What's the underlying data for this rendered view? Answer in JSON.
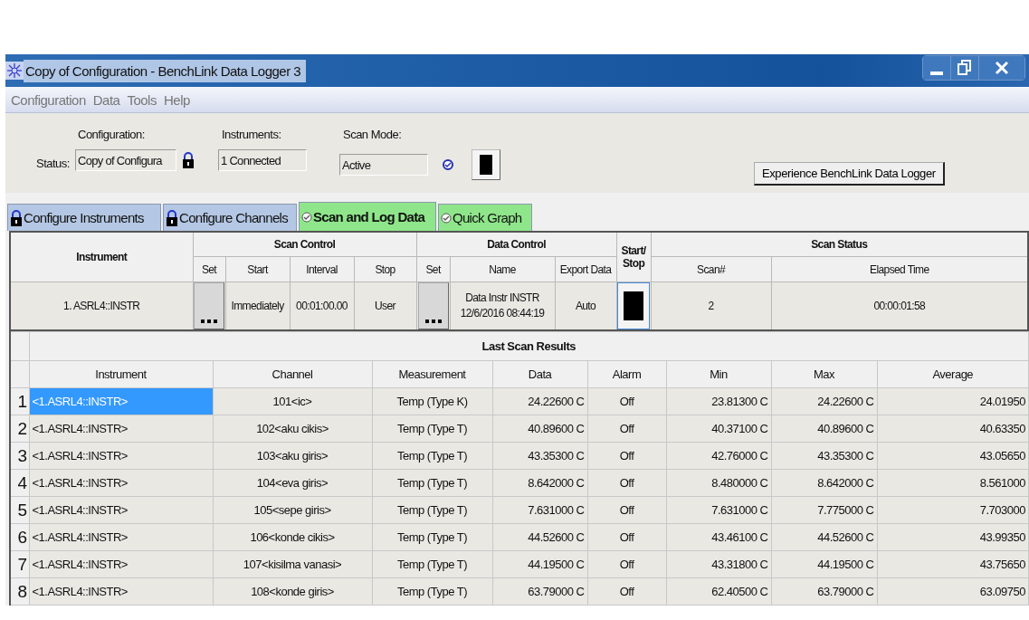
{
  "window": {
    "title": "Copy of Configuration - BenchLink Data Logger 3"
  },
  "menu": [
    "Configuration",
    "Data",
    "Tools",
    "Help"
  ],
  "status_panel": {
    "configuration_label": "Configuration:",
    "status_label": "Status:",
    "configuration_value": "Copy of Configura",
    "locked": true,
    "instruments_label": "Instruments:",
    "instruments_value": "1 Connected",
    "scan_mode_label": "Scan Mode:",
    "scan_mode_value": "Active",
    "scan_mode_checked": true,
    "action_button": "Experience BenchLink Data Logger"
  },
  "tabs": [
    {
      "label": "Configure Instruments",
      "kind": "lock",
      "selected": false
    },
    {
      "label": "Configure Channels",
      "kind": "lock",
      "selected": false
    },
    {
      "label": "Scan and Log Data",
      "kind": "check",
      "selected": true
    },
    {
      "label": "Quick Graph",
      "kind": "check",
      "selected": false
    }
  ],
  "scan_table": {
    "groups": [
      "Instrument",
      "Scan Control",
      "Data  Control",
      "Start/ Stop",
      "Scan Status"
    ],
    "columns": [
      "Set",
      "Start",
      "Interval",
      "Stop",
      "Set",
      "Name",
      "Export Data",
      "Scan#",
      "Elapsed Time"
    ],
    "row": {
      "instrument": "1. ASRL4::INSTR",
      "start": "Immediately",
      "interval": "00:01:00.00",
      "stop": "User",
      "name": "Data Instr INSTR 12/6/2016 08:44:19",
      "export_data": "Auto",
      "scan_number": "2",
      "elapsed_time": "00:00:01:58"
    }
  },
  "results": {
    "title": "Last Scan Results",
    "columns": [
      "Instrument",
      "Channel",
      "Measurement",
      "Data",
      "Alarm",
      "Min",
      "Max",
      "Average"
    ],
    "rows": [
      {
        "number": "1",
        "selected": true,
        "cells": [
          "<1.ASRL4::INSTR>",
          "101<ic>",
          "Temp (Type K)",
          "24.22600 C",
          "Off",
          "23.81300 C",
          "24.22600 C",
          "24.01950"
        ]
      },
      {
        "number": "2",
        "selected": false,
        "cells": [
          "<1.ASRL4::INSTR>",
          "102<aku cikis>",
          "Temp (Type T)",
          "40.89600 C",
          "Off",
          "40.37100 C",
          "40.89600 C",
          "40.63350"
        ]
      },
      {
        "number": "3",
        "selected": false,
        "cells": [
          "<1.ASRL4::INSTR>",
          "103<aku giris>",
          "Temp (Type T)",
          "43.35300 C",
          "Off",
          "42.76000 C",
          "43.35300 C",
          "43.05650"
        ]
      },
      {
        "number": "4",
        "selected": false,
        "cells": [
          "<1.ASRL4::INSTR>",
          "104<eva giris>",
          "Temp (Type T)",
          "8.642000 C",
          "Off",
          "8.480000 C",
          "8.642000 C",
          "8.561000"
        ]
      },
      {
        "number": "5",
        "selected": false,
        "cells": [
          "<1.ASRL4::INSTR>",
          "105<sepe giris>",
          "Temp (Type T)",
          "7.631000 C",
          "Off",
          "7.631000 C",
          "7.775000 C",
          "7.703000"
        ]
      },
      {
        "number": "6",
        "selected": false,
        "cells": [
          "<1.ASRL4::INSTR>",
          "106<konde cikis>",
          "Temp (Type T)",
          "44.52600 C",
          "Off",
          "43.46100 C",
          "44.52600 C",
          "43.99350"
        ]
      },
      {
        "number": "7",
        "selected": false,
        "cells": [
          "<1.ASRL4::INSTR>",
          "107<kisilma vanasi>",
          "Temp (Type T)",
          "44.19500 C",
          "Off",
          "43.31800 C",
          "44.19500 C",
          "43.75650"
        ]
      },
      {
        "number": "8",
        "selected": false,
        "cells": [
          "<1.ASRL4::INSTR>",
          "108<konde giris>",
          "Temp (Type T)",
          "63.79000 C",
          "Off",
          "62.40500 C",
          "63.79000 C",
          "63.09750"
        ]
      }
    ]
  }
}
